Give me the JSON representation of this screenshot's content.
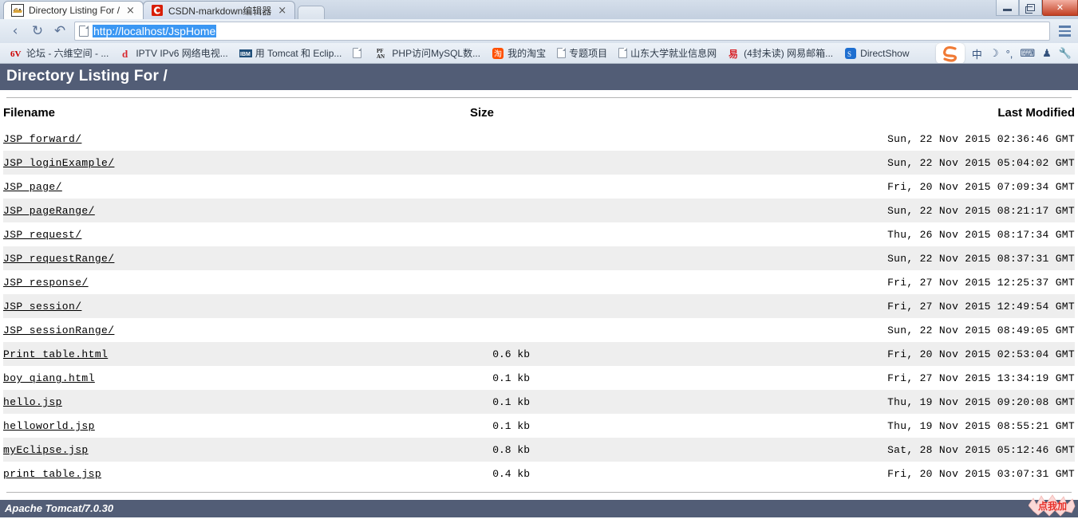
{
  "browser": {
    "tabs": [
      {
        "title": "Directory Listing For /",
        "favicon": "tomcat-icon",
        "active": true,
        "close_label": "×"
      },
      {
        "title": "CSDN-markdown编辑器",
        "favicon": "csdn-icon",
        "active": false,
        "close_label": "×"
      }
    ],
    "new_tab_label": "",
    "window_controls": {
      "minimize": "minimize-icon",
      "restore": "restore-icon",
      "close": "✕"
    },
    "nav": {
      "back": "‹",
      "reload": "↻",
      "forward_history": "↶"
    },
    "omnibox": {
      "value": "http://localhost/JspHome",
      "placeholder": "",
      "icon": "page-icon"
    },
    "menu": "hamburger-menu-icon",
    "bookmarks": [
      {
        "label": "论坛 - 六维空间 - ...",
        "icon": "6v-icon"
      },
      {
        "label": "IPTV IPv6 网络电视...",
        "icon": "d-icon"
      },
      {
        "label": "用 Tomcat 和 Eclip...",
        "icon": "ibm-icon"
      },
      {
        "label": "",
        "icon": "doc-icon"
      },
      {
        "label": "PHP访问MySQL数...",
        "icon": "pfan-icon"
      },
      {
        "label": "我的淘宝",
        "icon": "taobao-icon"
      },
      {
        "label": "专题项目",
        "icon": "doc-icon"
      },
      {
        "label": "山东大学就业信息网",
        "icon": "doc-icon"
      },
      {
        "label": "(4封未读) 网易邮箱...",
        "icon": "netease-icon"
      },
      {
        "label": "DirectShow",
        "icon": "directshow-icon"
      }
    ],
    "ime": {
      "logo": "sogou-logo",
      "items": [
        {
          "label": "中",
          "name": "ime-mode-chinese"
        },
        {
          "label": "☽",
          "name": "ime-moon-icon"
        },
        {
          "label": "°,",
          "name": "ime-punctuation-icon"
        },
        {
          "label": "⌨",
          "name": "ime-keyboard-icon"
        },
        {
          "label": "♟",
          "name": "ime-user-icon"
        },
        {
          "label": "🔧",
          "name": "ime-wrench-icon"
        }
      ]
    }
  },
  "page": {
    "banner_title": "Directory Listing For /",
    "footer_text": "Apache Tomcat/7.0.30",
    "columns": {
      "filename": "Filename",
      "size": "Size",
      "last_modified": "Last Modified"
    },
    "rows": [
      {
        "name": "JSP forward/",
        "size": "",
        "modified": "Sun, 22 Nov 2015 02:36:46 GMT"
      },
      {
        "name": "JSP loginExample/",
        "size": "",
        "modified": "Sun, 22 Nov 2015 05:04:02 GMT"
      },
      {
        "name": "JSP page/",
        "size": "",
        "modified": "Fri, 20 Nov 2015 07:09:34 GMT"
      },
      {
        "name": "JSP pageRange/",
        "size": "",
        "modified": "Sun, 22 Nov 2015 08:21:17 GMT"
      },
      {
        "name": "JSP request/",
        "size": "",
        "modified": "Thu, 26 Nov 2015 08:17:34 GMT"
      },
      {
        "name": "JSP requestRange/",
        "size": "",
        "modified": "Sun, 22 Nov 2015 08:37:31 GMT"
      },
      {
        "name": "JSP response/",
        "size": "",
        "modified": "Fri, 27 Nov 2015 12:25:37 GMT"
      },
      {
        "name": "JSP session/",
        "size": "",
        "modified": "Fri, 27 Nov 2015 12:49:54 GMT"
      },
      {
        "name": "JSP sessionRange/",
        "size": "",
        "modified": "Sun, 22 Nov 2015 08:49:05 GMT"
      },
      {
        "name": "Print table.html",
        "size": "0.6 kb",
        "modified": "Fri, 20 Nov 2015 02:53:04 GMT"
      },
      {
        "name": "boy qiang.html",
        "size": "0.1 kb",
        "modified": "Fri, 27 Nov 2015 13:34:19 GMT"
      },
      {
        "name": "hello.jsp",
        "size": "0.1 kb",
        "modified": "Thu, 19 Nov 2015 09:20:08 GMT"
      },
      {
        "name": "helloworld.jsp",
        "size": "0.1 kb",
        "modified": "Thu, 19 Nov 2015 08:55:21 GMT"
      },
      {
        "name": "myEclipse.jsp",
        "size": "0.8 kb",
        "modified": "Sat, 28 Nov 2015 05:12:46 GMT"
      },
      {
        "name": "print table.jsp",
        "size": "0.4 kb",
        "modified": "Fri, 20 Nov 2015 03:07:31 GMT"
      }
    ],
    "float_badge": "点我加"
  },
  "colors": {
    "banner": "#525D76",
    "row_alt": "#eeeeee",
    "url_selection": "#3b97f3",
    "badge_red": "#e8302a"
  }
}
